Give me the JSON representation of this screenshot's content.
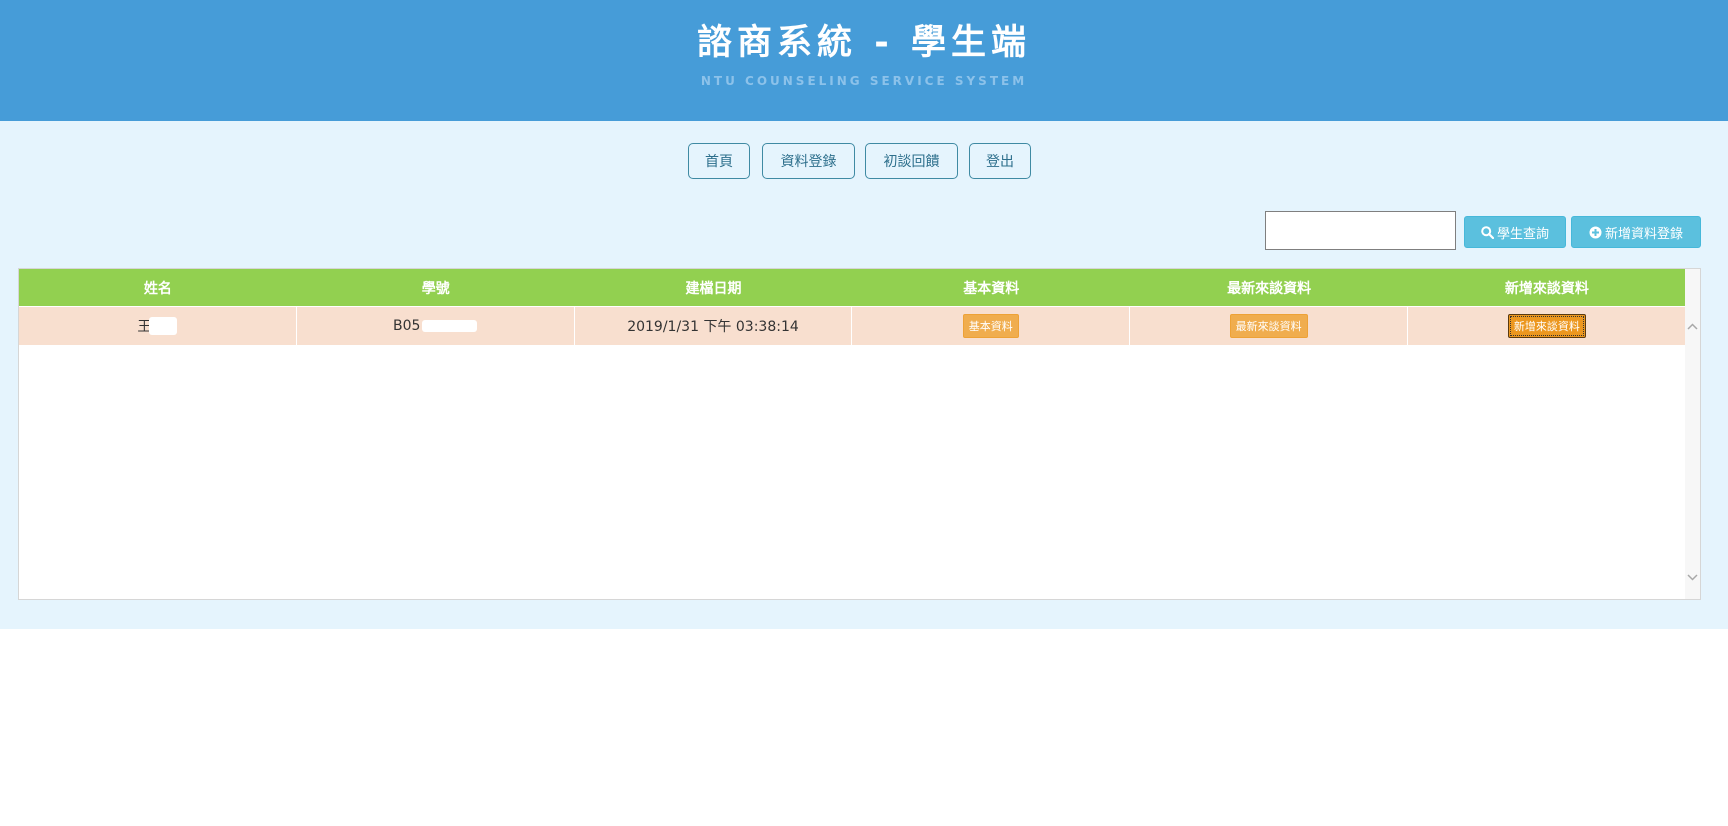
{
  "header": {
    "title": "諮商系統 - 學生端",
    "subtitle": "NTU COUNSELING SERVICE SYSTEM"
  },
  "nav": [
    {
      "label": "首頁"
    },
    {
      "label": "資料登錄"
    },
    {
      "label": "初談回饋"
    },
    {
      "label": "登出"
    }
  ],
  "search": {
    "value": "",
    "placeholder": ""
  },
  "actions": {
    "search_label": "學生查詢",
    "add_label": "新增資料登錄"
  },
  "table": {
    "columns": [
      "姓名",
      "學號",
      "建檔日期",
      "基本資料",
      "最新來談資料",
      "新增來談資料"
    ],
    "rows": [
      {
        "name": "王",
        "student_id": "B05",
        "created": "2019/1/31 下午 03:38:14",
        "basic_btn": "基本資料",
        "latest_btn": "最新來談資料",
        "new_btn": "新增來談資料"
      }
    ]
  },
  "colors": {
    "header_bg": "#469cd8",
    "content_bg": "#e5f4fd",
    "table_header": "#92d050",
    "row_bg": "#f8dfcf",
    "tag_btn": "#f0ad4e",
    "action_btn": "#5bc0de"
  },
  "icons": {
    "search": "search-icon",
    "add": "plus-circle-icon",
    "scroll_up": "chevron-up-icon",
    "scroll_down": "chevron-down-icon"
  }
}
